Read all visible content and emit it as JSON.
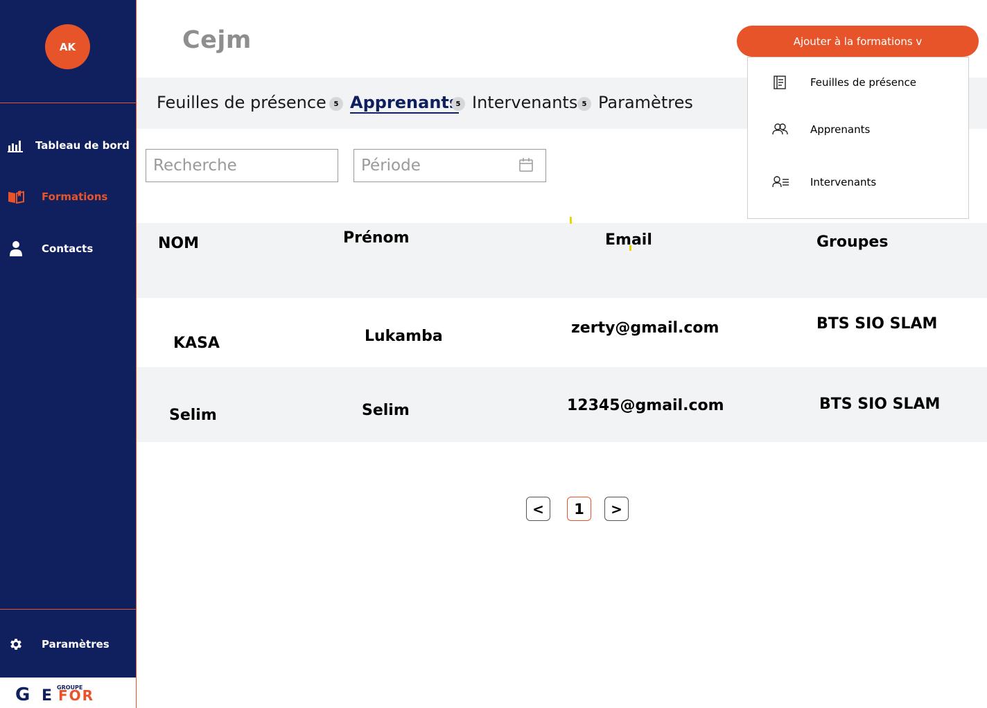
{
  "sidebar": {
    "avatar_initials": "AK",
    "items": [
      {
        "label": "Tableau de bord",
        "icon": "bar-chart-icon"
      },
      {
        "label": "Formations",
        "icon": "book-icon"
      },
      {
        "label": "Contacts",
        "icon": "person-icon"
      }
    ],
    "settings_label": "Paramètres",
    "settings_icon": "gear-icon",
    "logo": {
      "top_text": "GROUPE",
      "main_left": "G",
      "main_e": "E",
      "main_right": "FOR"
    }
  },
  "header": {
    "title": "Cejm",
    "add_button_label": "Ajouter à la formations v"
  },
  "tabs": [
    {
      "label": "Feuilles de présence",
      "badge": "5"
    },
    {
      "label": "Apprenants",
      "badge": "5"
    },
    {
      "label": "Intervenants",
      "badge": "5"
    },
    {
      "label": "Paramètres"
    }
  ],
  "filters": {
    "search_placeholder": "Recherche",
    "period_placeholder": "Période"
  },
  "table": {
    "headers": [
      "NOM",
      "Prénom",
      "Email",
      "Groupes"
    ],
    "rows": [
      [
        "KASA",
        "Lukamba",
        "zerty@gmail.com",
        "BTS SIO SLAM"
      ],
      [
        "Selim",
        "Selim",
        "12345@gmail.com",
        "BTS SIO SLAM"
      ]
    ]
  },
  "pagination": {
    "prev": "<",
    "current": "1",
    "next": ">"
  },
  "dropdown": {
    "items": [
      {
        "label": "Feuilles de présence",
        "icon": "document-list-icon"
      },
      {
        "label": "Apprenants",
        "icon": "users-icon"
      },
      {
        "label": "Intervenants",
        "icon": "user-list-icon"
      }
    ]
  },
  "colors": {
    "sidebar": "#10205f",
    "accent": "#e8542a",
    "tab_bg": "#f2f3f5"
  }
}
